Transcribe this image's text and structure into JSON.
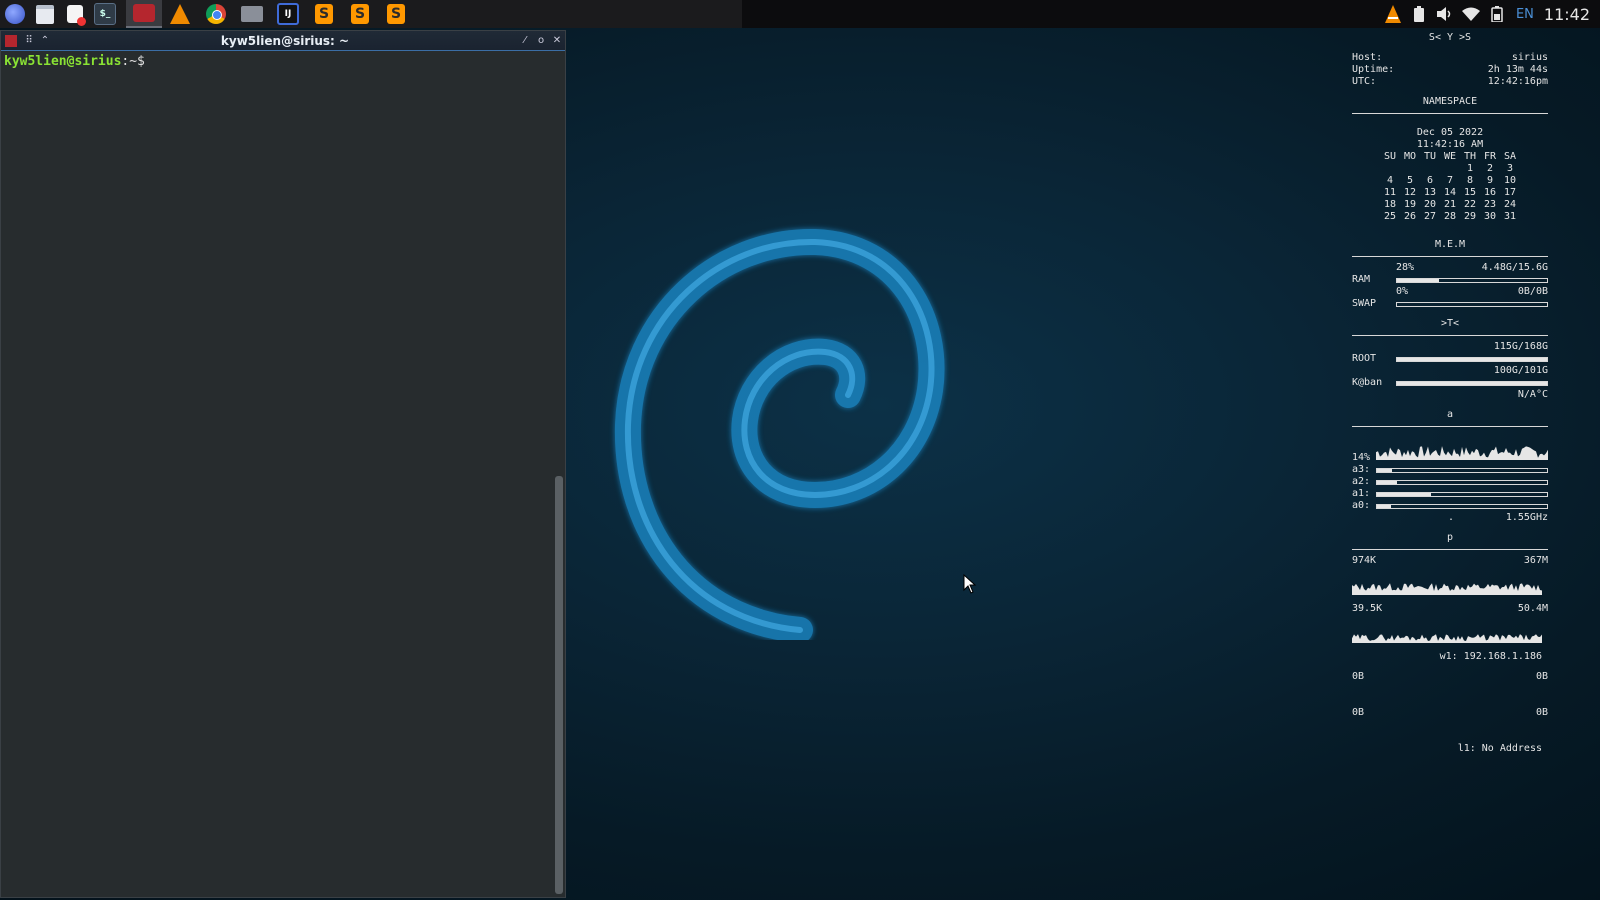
{
  "taskbar": {
    "pinned": [
      {
        "name": "whisker-menu-icon",
        "style": "ico-whisker",
        "glyph": ""
      },
      {
        "name": "file-manager-icon",
        "style": "ico-files",
        "glyph": ""
      },
      {
        "name": "mail-icon",
        "style": "ico-mail",
        "glyph": ""
      },
      {
        "name": "terminal-launcher-icon",
        "style": "ico-term",
        "glyph": "$_"
      }
    ],
    "apps": [
      {
        "name": "terminal-window-task-icon",
        "style": "ico-red",
        "glyph": "",
        "active": true
      },
      {
        "name": "vlc-icon",
        "style": "ico-vlc",
        "glyph": ""
      },
      {
        "name": "chrome-icon",
        "style": "ico-chrome",
        "glyph": ""
      },
      {
        "name": "folder-icon",
        "style": "ico-folder",
        "glyph": ""
      },
      {
        "name": "intellij-icon",
        "style": "ico-ij",
        "glyph": "IJ"
      },
      {
        "name": "sublime-text-icon",
        "style": "ico-sublime",
        "glyph": "S"
      },
      {
        "name": "sublime-text-icon",
        "style": "ico-sublime",
        "glyph": "S"
      },
      {
        "name": "sublime-text-icon",
        "style": "ico-sublime",
        "glyph": "S"
      }
    ],
    "tray": {
      "language": "EN",
      "clock": "11:42"
    }
  },
  "terminal": {
    "title": "kyw5lien@sirius: ~",
    "prompt_user": "kyw5lien@sirius",
    "prompt_rest": ":~$"
  },
  "conky": {
    "header": "S< Y >S",
    "host_label": "Host:",
    "host": "sirius",
    "uptime_label": "Uptime:",
    "uptime": "2h 13m 44s",
    "utc_label": "UTC:",
    "utc": "12:42:16pm",
    "namespace": "NAMESPACE",
    "date": "Dec 05 2022",
    "time": "11:42:16 AM",
    "cal_head": [
      "SU",
      "MO",
      "TU",
      "WE",
      "TH",
      "FR",
      "SA"
    ],
    "cal_days": [
      "",
      "",
      "",
      "",
      "1",
      "2",
      "3",
      "4",
      "5",
      "6",
      "7",
      "8",
      "9",
      "10",
      "11",
      "12",
      "13",
      "14",
      "15",
      "16",
      "17",
      "18",
      "19",
      "20",
      "21",
      "22",
      "23",
      "24",
      "25",
      "26",
      "27",
      "28",
      "29",
      "30",
      "31"
    ],
    "mem_title": "M.E.M",
    "ram_pct": "28%",
    "ram_val": "4.48G/15.6G",
    "ram_label": "RAM",
    "ram_fill": 0.28,
    "swap_pct": "0%",
    "swap_val": "0B/0B",
    "swap_label": "SWAP",
    "swap_fill": 0,
    "disk_title": ">T<",
    "root_val": "115G/168G",
    "root_label": "ROOT",
    "root_fill": 1.0,
    "kban_val": "100G/101G",
    "kban_label": "K@ban",
    "kban_fill": 1.0,
    "temp": "N/A°C",
    "cpu_title": "a",
    "cpu_pct": "14%",
    "cores": [
      {
        "label": "a3:",
        "fill": 0.09
      },
      {
        "label": "a2:",
        "fill": 0.12
      },
      {
        "label": "a1:",
        "fill": 0.32
      },
      {
        "label": "a0:",
        "fill": 0.08
      }
    ],
    "cpu_dot": ".",
    "cpu_freq": "1.55GHz",
    "net_title": "p",
    "down_rate": "974K",
    "down_total": "367M",
    "up_rate": "39.5K",
    "up_total": "50.4M",
    "wlan": "w1: 192.168.1.186",
    "eth_a1": "0B",
    "eth_a2": "0B",
    "eth_b1": "0B",
    "eth_b2": "0B",
    "lan": "l1: No Address"
  }
}
